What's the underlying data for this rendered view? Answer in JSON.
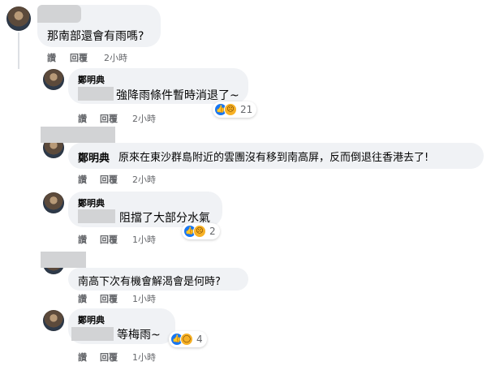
{
  "comments": [
    {
      "text": "那南部還會有雨嗎?",
      "actions": {
        "like": "讚",
        "reply": "回覆"
      },
      "time": "2小時"
    },
    {
      "name": "鄭明典",
      "text": "強降雨條件暫時消退了~",
      "actions": {
        "like": "讚",
        "reply": "回覆"
      },
      "time": "2小時",
      "reactions": {
        "icons": [
          "like-icon",
          "sad-icon"
        ],
        "count": "21"
      }
    },
    {
      "name": "鄭明典",
      "text": "原來在東沙群島附近的雲團沒有移到南高屏，反而倒退往香港去了!",
      "actions": {
        "like": "讚",
        "reply": "回覆"
      },
      "time": "2小時"
    },
    {
      "name": "鄭明典",
      "text": "阻擋了大部分水氣",
      "actions": {
        "like": "讚",
        "reply": "回覆"
      },
      "time": "1小時",
      "reactions": {
        "icons": [
          "like-icon",
          "sad-icon"
        ],
        "count": "2"
      }
    },
    {
      "text": "南高下次有機會解渴會是何時?",
      "actions": {
        "like": "讚",
        "reply": "回覆"
      },
      "time": "1小時"
    },
    {
      "name": "鄭明典",
      "text": "等梅雨~",
      "actions": {
        "like": "讚",
        "reply": "回覆"
      },
      "time": "1小時",
      "reactions": {
        "icons": [
          "like-icon",
          "wow-icon"
        ],
        "count": "4"
      }
    }
  ],
  "colors": {
    "bubble": "#f0f2f5",
    "redaction": "#d2d3d5",
    "like": "#1877f2",
    "emoji": "#f7b125",
    "meta": "#65676b"
  }
}
